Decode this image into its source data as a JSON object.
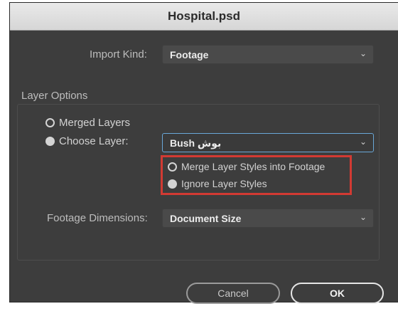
{
  "window": {
    "title": "Hospital.psd"
  },
  "import_kind": {
    "label": "Import Kind:",
    "value": "Footage"
  },
  "layer_options": {
    "title": "Layer Options",
    "merged_layers": "Merged Layers",
    "choose_layer": "Choose Layer:",
    "layer_value": "Bush بوش",
    "merge_styles": "Merge Layer Styles into Footage",
    "ignore_styles": "Ignore Layer Styles",
    "selected_layer_mode": "choose_layer",
    "selected_style_mode": "ignore_styles"
  },
  "footage_dimensions": {
    "label": "Footage Dimensions:",
    "value": "Document Size"
  },
  "buttons": {
    "cancel": "Cancel",
    "ok": "OK"
  },
  "icons": {
    "dropdown": "chevron-down-icon"
  },
  "colors": {
    "highlight": "#d23a33",
    "focus": "#6aa8d8"
  }
}
